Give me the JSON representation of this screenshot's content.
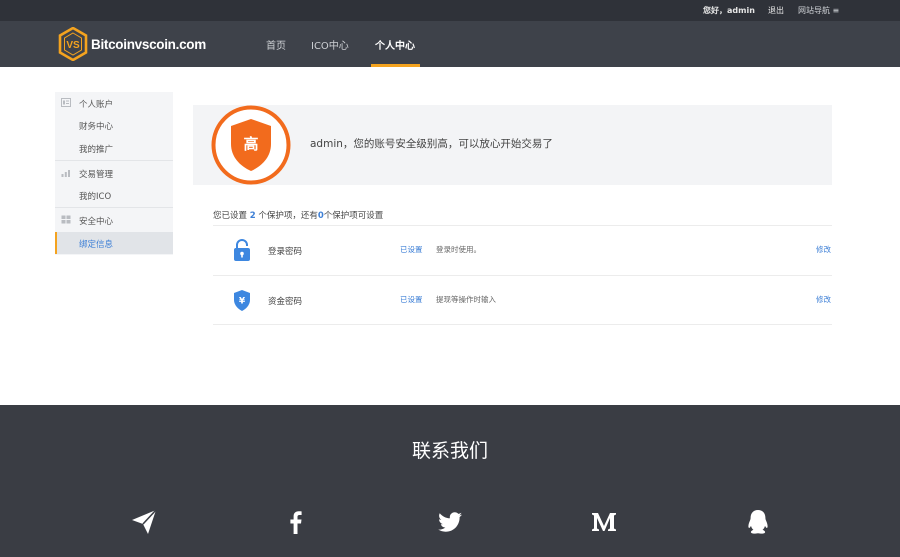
{
  "topbar": {
    "greeting": "您好，admin",
    "logout": "退出",
    "site_nav": "网站导航 ≡"
  },
  "header": {
    "logo_text": "Bitcoinvscoin.com",
    "logo_mark_text": "VS",
    "nav": [
      "首页",
      "ICO中心",
      "个人中心"
    ],
    "active_nav": "个人中心",
    "accent_color": "#f4a31f"
  },
  "sidebar": {
    "groups": [
      {
        "title": "个人账户",
        "icon": "user-account-icon",
        "items": [
          "财务中心",
          "我的推广"
        ]
      },
      {
        "title": "交易管理",
        "icon": "chart-icon",
        "items": [
          "我的ICO"
        ]
      },
      {
        "title": "安全中心",
        "icon": "grid-icon",
        "items": [
          "绑定信息"
        ]
      }
    ],
    "active_item": "绑定信息"
  },
  "security": {
    "level_char": "高",
    "level_color": "#f26b1d",
    "message": "admin，您的账号安全级别高，可以放心开始交易了",
    "summary_prefix": "您已设置",
    "set_count": "2",
    "summary_mid": "个保护项，还有",
    "unset_count": "0",
    "summary_suffix": "个保护项可设置",
    "rows": [
      {
        "icon": "lock-icon",
        "name": "登录密码",
        "status": "已设置",
        "desc": "登录时使用。",
        "action": "修改"
      },
      {
        "icon": "yuan-shield-icon",
        "name": "资金密码",
        "status": "已设置",
        "desc": "提现等操作时输入",
        "action": "修改"
      }
    ]
  },
  "footer": {
    "title": "联系我们",
    "social": [
      "telegram-icon",
      "facebook-icon",
      "twitter-icon",
      "medium-icon",
      "qq-icon"
    ]
  }
}
